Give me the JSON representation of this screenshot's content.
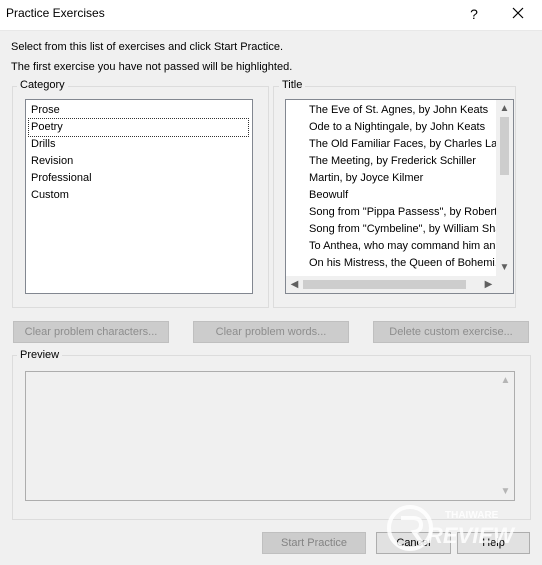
{
  "window": {
    "title": "Practice Exercises",
    "help_glyph": "?",
    "close_icon": "close-icon"
  },
  "instructions": {
    "line1": "Select from this list of exercises and click Start Practice.",
    "line2": "The first exercise you have not passed will be highlighted."
  },
  "category": {
    "label": "Category",
    "items": [
      "Prose",
      "Poetry",
      "Drills",
      "Revision",
      "Professional",
      "Custom"
    ],
    "selected": "Poetry"
  },
  "titles": {
    "label": "Title",
    "items": [
      "The Eve of St. Agnes, by John Keats",
      "Ode to a Nightingale, by John Keats",
      "The Old Familiar Faces, by Charles Lam",
      "The Meeting, by Frederick Schiller",
      "Martin, by Joyce Kilmer",
      "Beowulf",
      "Song from \"Pippa Passess\", by Robert .",
      "Song from \"Cymbeline\", by William Sha",
      "To Anthea, who may command him an.",
      "On his Mistress, the Queen of Bohemi."
    ]
  },
  "actions": {
    "clear_chars": "Clear problem characters...",
    "clear_words": "Clear problem words...",
    "delete_custom": "Delete custom exercise..."
  },
  "preview": {
    "label": "Preview"
  },
  "footer": {
    "start": "Start Practice",
    "cancel": "Cancel",
    "help": "Help"
  },
  "watermark": {
    "brand_top": "THAIWARE",
    "brand_bottom": "REVIEW"
  }
}
